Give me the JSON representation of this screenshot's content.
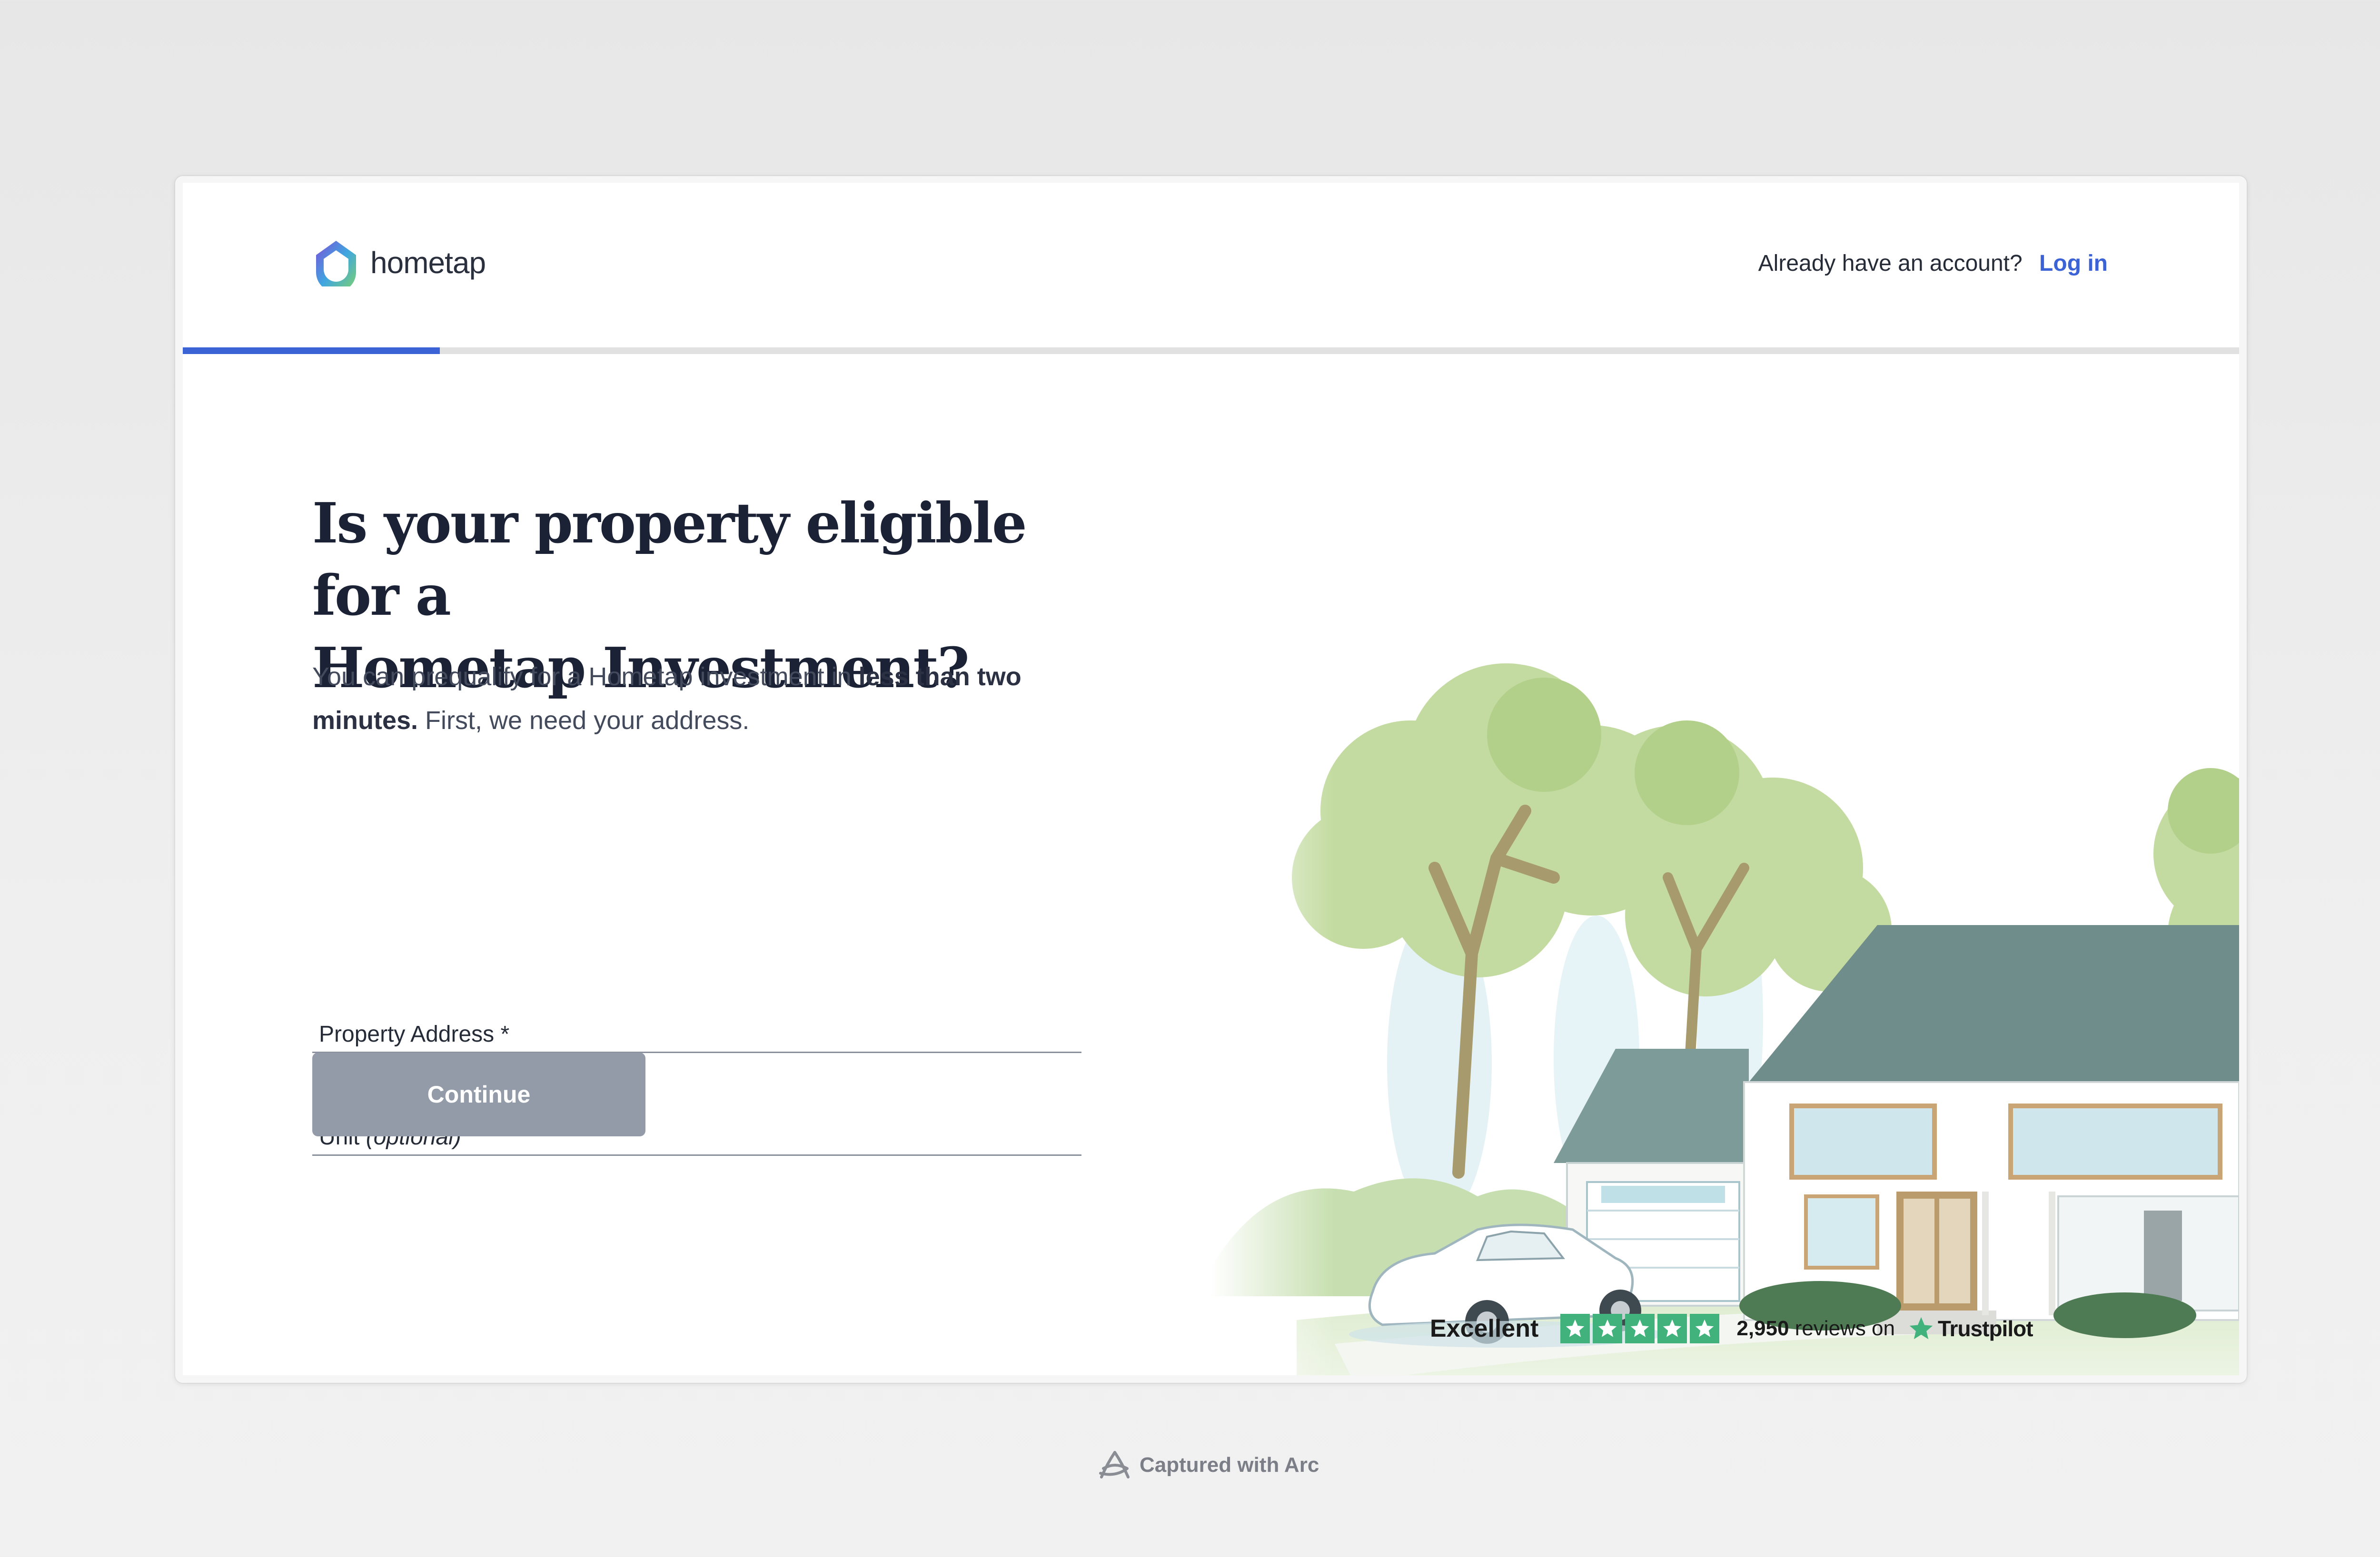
{
  "header": {
    "brand": "hometap",
    "account_prompt": "Already have an account?",
    "login_label": "Log in"
  },
  "progress": {
    "fraction": 0.125
  },
  "main": {
    "title_line1": "Is your property eligible for a",
    "title_line2": "Hometap Investment?",
    "subtitle_part1": "You can prequalify for a Hometap investment in ",
    "subtitle_bold1": "less than two minutes.",
    "subtitle_part2": " First, we need your address.",
    "address_label": "Property Address *",
    "unit_label": "Unit",
    "unit_optional": "(optional)",
    "continue_label": "Continue"
  },
  "trustpilot": {
    "rating_text": "Excellent",
    "stars": 5,
    "review_count": "2,950",
    "reviews_on": "reviews on",
    "brand": "Trustpilot"
  },
  "footer": {
    "captured_with": "Captured with Arc"
  },
  "colors": {
    "accent": "#3c63d6",
    "button_disabled": "#939aa8",
    "trustpilot_green": "#41b27c",
    "title": "#1b2236"
  },
  "icons": {
    "logo": "hometap-house-ring-icon",
    "star": "star-icon",
    "trustpilot": "trustpilot-star-icon",
    "arc": "arc-logo-icon"
  }
}
